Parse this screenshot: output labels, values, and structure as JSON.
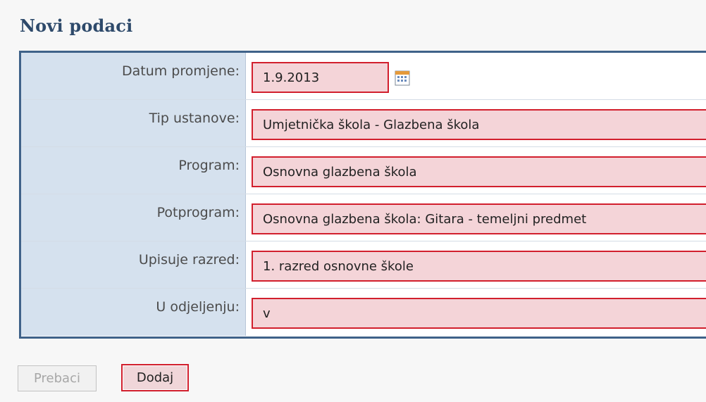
{
  "section": {
    "title": "Novi podaci"
  },
  "form": {
    "fields": [
      {
        "label": "Datum promjene:",
        "value": "1.9.2013"
      },
      {
        "label": "Tip ustanove:",
        "value": "Umjetnička škola - Glazbena škola"
      },
      {
        "label": "Program:",
        "value": "Osnovna glazbena škola"
      },
      {
        "label": "Potprogram:",
        "value": "Osnovna glazbena škola: Gitara - temeljni predmet"
      },
      {
        "label": "Upisuje razred:",
        "value": "1. razred osnovne škole"
      },
      {
        "label": "U odjeljenju:",
        "value": "v"
      }
    ]
  },
  "buttons": {
    "prebaci": "Prebaci",
    "dodaj": "Dodaj"
  },
  "icons": {
    "date_picker": "calendar-icon"
  },
  "colors": {
    "title": "#2e4a6b",
    "frame_border": "#3f6289",
    "label_bg": "#d5e1ee",
    "error_border": "#d21f2d",
    "error_bg": "#f4d4d8"
  }
}
